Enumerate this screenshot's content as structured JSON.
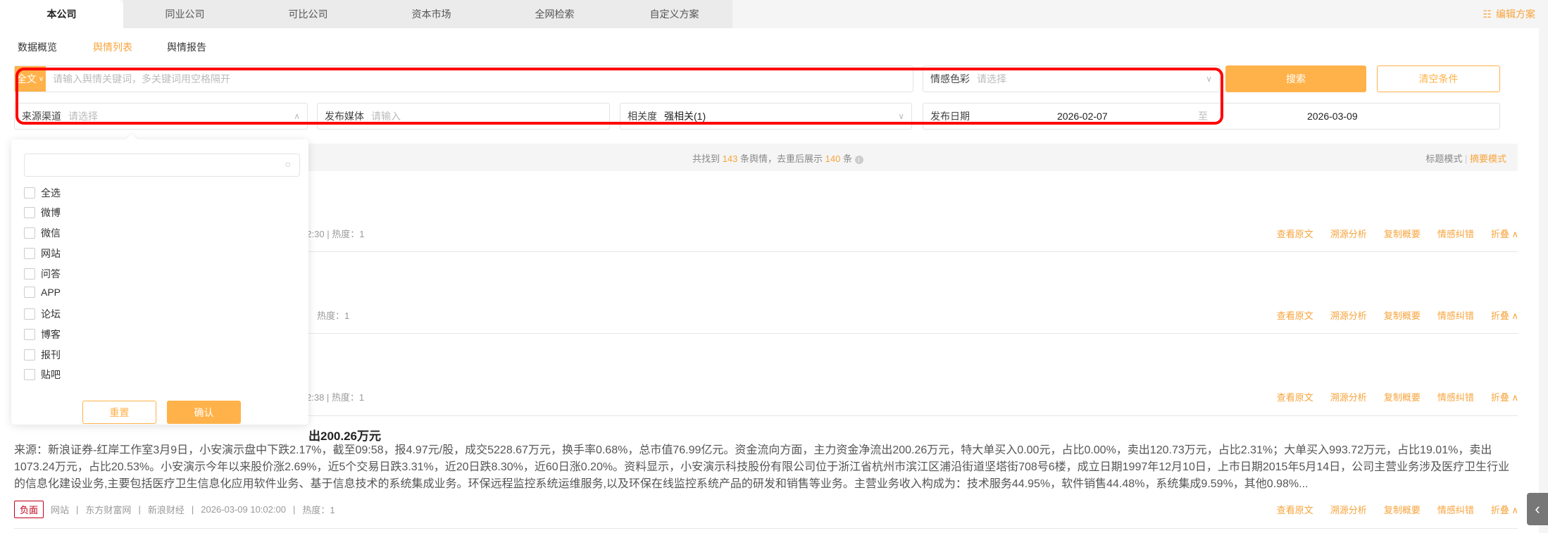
{
  "tabs": [
    "本公司",
    "同业公司",
    "可比公司",
    "资本市场",
    "全网检索",
    "自定义方案"
  ],
  "edit_label": "编辑方案",
  "subtabs": [
    "数据概览",
    "舆情列表",
    "舆情报告"
  ],
  "search": {
    "scope": "全文",
    "placeholder": "请输入舆情关键词，多关键词用空格隔开",
    "sentiment_label": "情感色彩",
    "sentiment_placeholder": "请选择",
    "search_btn": "搜索",
    "clear_btn": "清空条件"
  },
  "filters": {
    "source_label": "来源渠道",
    "source_placeholder": "请选择",
    "media_label": "发布媒体",
    "media_placeholder": "请输入",
    "relevance_label": "相关度",
    "relevance_value": "强相关(1)",
    "date_label": "发布日期",
    "date_from": "2026-02-07",
    "date_sep": "至",
    "date_to": "2026-03-09"
  },
  "summary": {
    "pre": "共找到",
    "total": "143",
    "mid": "条舆情，去重后展示",
    "shown": "140",
    "post": "条",
    "mode_title": "标题模式",
    "mode_summary": "摘要模式"
  },
  "popup": {
    "options": [
      "全选",
      "微博",
      "微信",
      "网站",
      "问答",
      "APP",
      "论坛",
      "博客",
      "报刊",
      "贴吧"
    ],
    "reset": "重置",
    "confirm": "确认"
  },
  "actions": [
    "查看原文",
    "溯源分析",
    "复制概要",
    "情感纠错",
    "折叠"
  ],
  "items": [
    {
      "meta": "13:42:30 | 热度：1"
    },
    {
      "meta": "热度：1"
    },
    {
      "meta": "2:38 | 热度：1"
    },
    {
      "title": "出200.26万元",
      "body": "来源：新浪证券-红岸工作室3月9日，小安演示盘中下跌2.17%，截至09:58，报4.97元/股，成交5228.67万元，换手率0.68%，总市值76.99亿元。资金流向方面，主力资金净流出200.26万元，特大单买入0.00元，占比0.00%，卖出120.73万元，占比2.31%；大单买入993.72万元，占比19.01%，卖出1073.24万元，占比20.53%。小安演示今年以来股价涨2.69%，近5个交易日跌3.31%，近20日跌8.30%，近60日涨0.20%。资料显示，小安演示科技股份有限公司位于浙江省杭州市滨江区浦沿街道坚塔街708号6楼，成立日期1997年12月10日，上市日期2015年5月14日，公司主营业务涉及医疗卫生行业的信息化建设业务,主要包括医疗卫生信息化应用软件业务、基于信息技术的系统集成业务。环保远程监控系统运维服务,以及环保在线监控系统产品的研发和销售等业务。主营业务收入构成为：技术服务44.95%，软件销售44.48%，系统集成9.59%，其他0.98%...",
      "sentiment": "负面",
      "channel": "网站",
      "site": "东方财富网",
      "source": "新浪财经",
      "time": "2026-03-09 10:02:00",
      "heat": "热度：1"
    }
  ]
}
